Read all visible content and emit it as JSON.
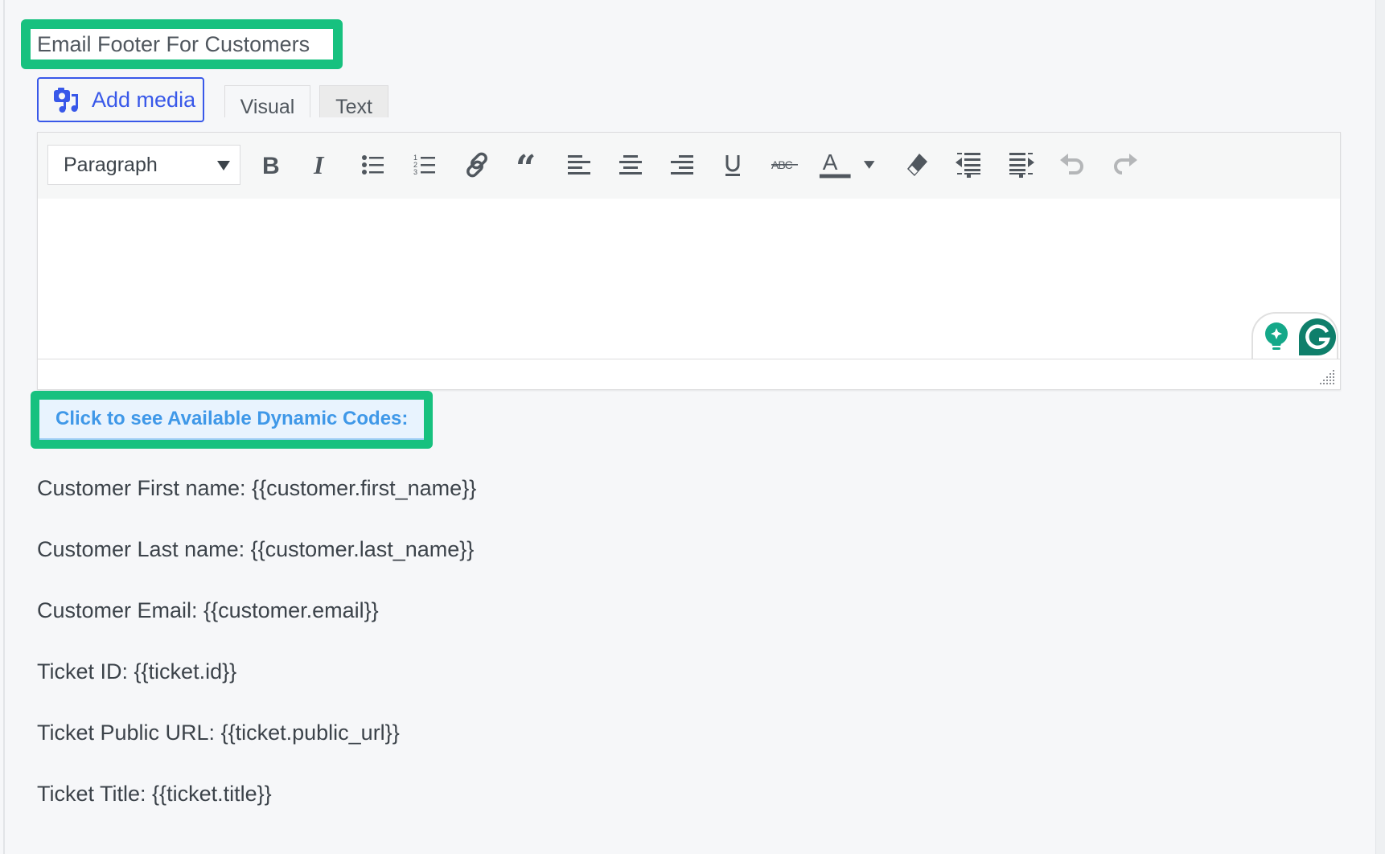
{
  "field_label": "Email Footer For Customers",
  "editor": {
    "add_media_label": "Add media",
    "tabs": [
      {
        "label": "Visual",
        "active": true
      },
      {
        "label": "Text",
        "active": false
      }
    ],
    "format_select": {
      "value": "Paragraph"
    },
    "toolbar_buttons": [
      {
        "name": "bold",
        "icon": "bold-icon"
      },
      {
        "name": "italic",
        "icon": "italic-icon"
      },
      {
        "name": "bulleted-list",
        "icon": "bulleted-list-icon"
      },
      {
        "name": "numbered-list",
        "icon": "numbered-list-icon"
      },
      {
        "name": "insert-link",
        "icon": "link-icon"
      },
      {
        "name": "blockquote",
        "icon": "blockquote-icon"
      },
      {
        "name": "align-left",
        "icon": "align-left-icon"
      },
      {
        "name": "align-center",
        "icon": "align-center-icon"
      },
      {
        "name": "align-right",
        "icon": "align-right-icon"
      },
      {
        "name": "underline",
        "icon": "underline-icon"
      },
      {
        "name": "strikethrough",
        "icon": "strikethrough-icon"
      },
      {
        "name": "text-color",
        "icon": "text-color-icon"
      },
      {
        "name": "clear-formatting",
        "icon": "eraser-icon"
      },
      {
        "name": "outdent",
        "icon": "outdent-icon"
      },
      {
        "name": "indent",
        "icon": "indent-icon"
      },
      {
        "name": "undo",
        "icon": "undo-icon"
      },
      {
        "name": "redo",
        "icon": "redo-icon"
      }
    ],
    "content": ""
  },
  "dynamic_codes": {
    "toggle_label": "Click to see Available Dynamic Codes:",
    "items": [
      "Customer First name: {{customer.first_name}}",
      "Customer Last name: {{customer.last_name}}",
      "Customer Email: {{customer.email}}",
      "Ticket ID: {{ticket.id}}",
      "Ticket Public URL: {{ticket.public_url}}",
      "Ticket Title: {{ticket.title}}"
    ]
  },
  "colors": {
    "highlight": "#17c17f",
    "add_media_blue": "#3858e9",
    "link_blue": "#3f98e8",
    "grammarly_green": "#0f7f6b",
    "grammarly_light": "#15a889"
  }
}
